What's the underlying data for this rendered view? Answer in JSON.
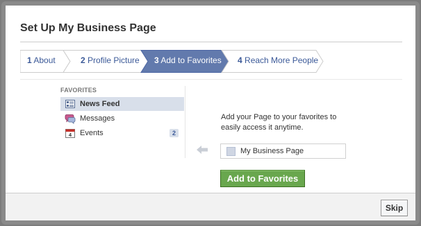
{
  "dialog": {
    "title": "Set Up My Business Page"
  },
  "steps": [
    {
      "num": "1",
      "label": "About",
      "active": false
    },
    {
      "num": "2",
      "label": "Profile Picture",
      "active": false
    },
    {
      "num": "3",
      "label": "Add to Favorites",
      "active": true
    },
    {
      "num": "4",
      "label": "Reach More People",
      "active": false
    }
  ],
  "favorites": {
    "heading": "FAVORITES",
    "items": [
      {
        "label": "News Feed",
        "icon": "news-feed-icon",
        "selected": true,
        "badge": ""
      },
      {
        "label": "Messages",
        "icon": "messages-icon",
        "selected": false,
        "badge": ""
      },
      {
        "label": "Events",
        "icon": "calendar-icon",
        "selected": false,
        "badge": "2"
      }
    ]
  },
  "panel": {
    "description": "Add your Page to your favorites to easily access it anytime.",
    "page_name": "My Business Page",
    "add_button": "Add to Favorites"
  },
  "footer": {
    "skip_button": "Skip"
  },
  "colors": {
    "brand": "#3b5998",
    "active_step": "#627aad",
    "add_button": "#69a74e",
    "selected_row": "#d8dfea"
  }
}
